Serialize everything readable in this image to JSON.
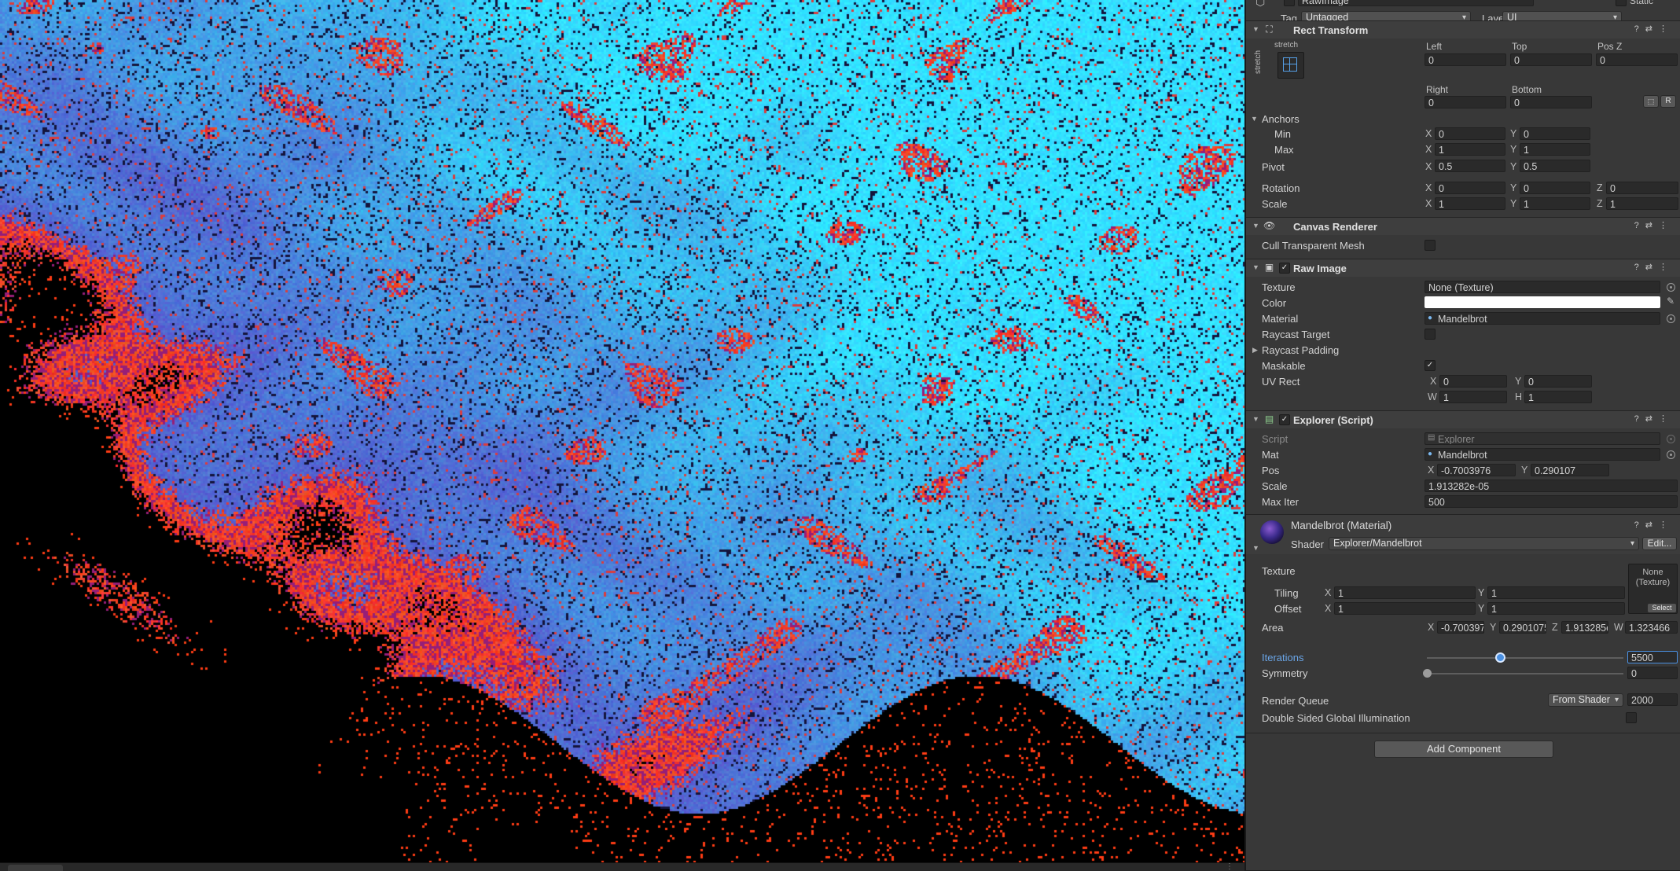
{
  "object": {
    "name": "RawImage",
    "static_label": "Static",
    "tag_label": "Tag",
    "tag_value": "Untagged",
    "layer_label": "Layer",
    "layer_value": "UI"
  },
  "rect_transform": {
    "title": "Rect Transform",
    "anchor_preset": "stretch",
    "left_label": "Left",
    "left": "0",
    "top_label": "Top",
    "top": "0",
    "posz_label": "Pos Z",
    "posz": "0",
    "right_label": "Right",
    "right": "0",
    "bottom_label": "Bottom",
    "bottom": "0",
    "r_button": "R",
    "anchors_label": "Anchors",
    "min_label": "Min",
    "min_x": "0",
    "min_y": "0",
    "max_label": "Max",
    "max_x": "1",
    "max_y": "1",
    "pivot_label": "Pivot",
    "pivot_x": "0.5",
    "pivot_y": "0.5",
    "rotation_label": "Rotation",
    "rot_x": "0",
    "rot_y": "0",
    "rot_z": "0",
    "scale_label": "Scale",
    "scale_x": "1",
    "scale_y": "1",
    "scale_z": "1"
  },
  "canvas_renderer": {
    "title": "Canvas Renderer",
    "cull_label": "Cull Transparent Mesh"
  },
  "raw_image": {
    "title": "Raw Image",
    "texture_label": "Texture",
    "texture": "None (Texture)",
    "color_label": "Color",
    "material_label": "Material",
    "material": "Mandelbrot",
    "raycast_target_label": "Raycast Target",
    "raycast_padding_label": "Raycast Padding",
    "maskable_label": "Maskable",
    "uvrect_label": "UV Rect",
    "uv_x": "0",
    "uv_y": "0",
    "uv_w": "1",
    "uv_h": "1"
  },
  "explorer": {
    "title": "Explorer (Script)",
    "script_label": "Script",
    "script": "Explorer",
    "mat_label": "Mat",
    "mat": "Mandelbrot",
    "pos_label": "Pos",
    "pos_x": "-0.7003976",
    "pos_y": "0.290107",
    "scale_label": "Scale",
    "scale": "1.913282e-05",
    "maxiter_label": "Max Iter",
    "maxiter": "500"
  },
  "material": {
    "title": "Mandelbrot (Material)",
    "shader_label": "Shader",
    "shader": "Explorer/Mandelbrot",
    "edit_button": "Edit...",
    "texture_label": "Texture",
    "texture_slot": "None\n(Texture)",
    "select_button": "Select",
    "tiling_label": "Tiling",
    "tiling_x": "1",
    "tiling_y": "1",
    "offset_label": "Offset",
    "offset_x": "1",
    "offset_y": "1",
    "area_label": "Area",
    "area_x": "-0.700397",
    "area_y": "0.2901075",
    "area_z": "1.913285e",
    "area_w": "1.323466",
    "iterations_label": "Iterations",
    "iterations": "5500",
    "iterations_fraction": 0.37,
    "symmetry_label": "Symmetry",
    "symmetry": "0",
    "symmetry_fraction": 0.0,
    "render_queue_label": "Render Queue",
    "render_queue_mode": "From Shader",
    "render_queue": "2000",
    "dsgi_label": "Double Sided Global Illumination"
  },
  "add_component": "Add Component",
  "colors": {
    "accent": "#4a90e2",
    "panel": "#383838",
    "header": "#3e3e3e"
  }
}
